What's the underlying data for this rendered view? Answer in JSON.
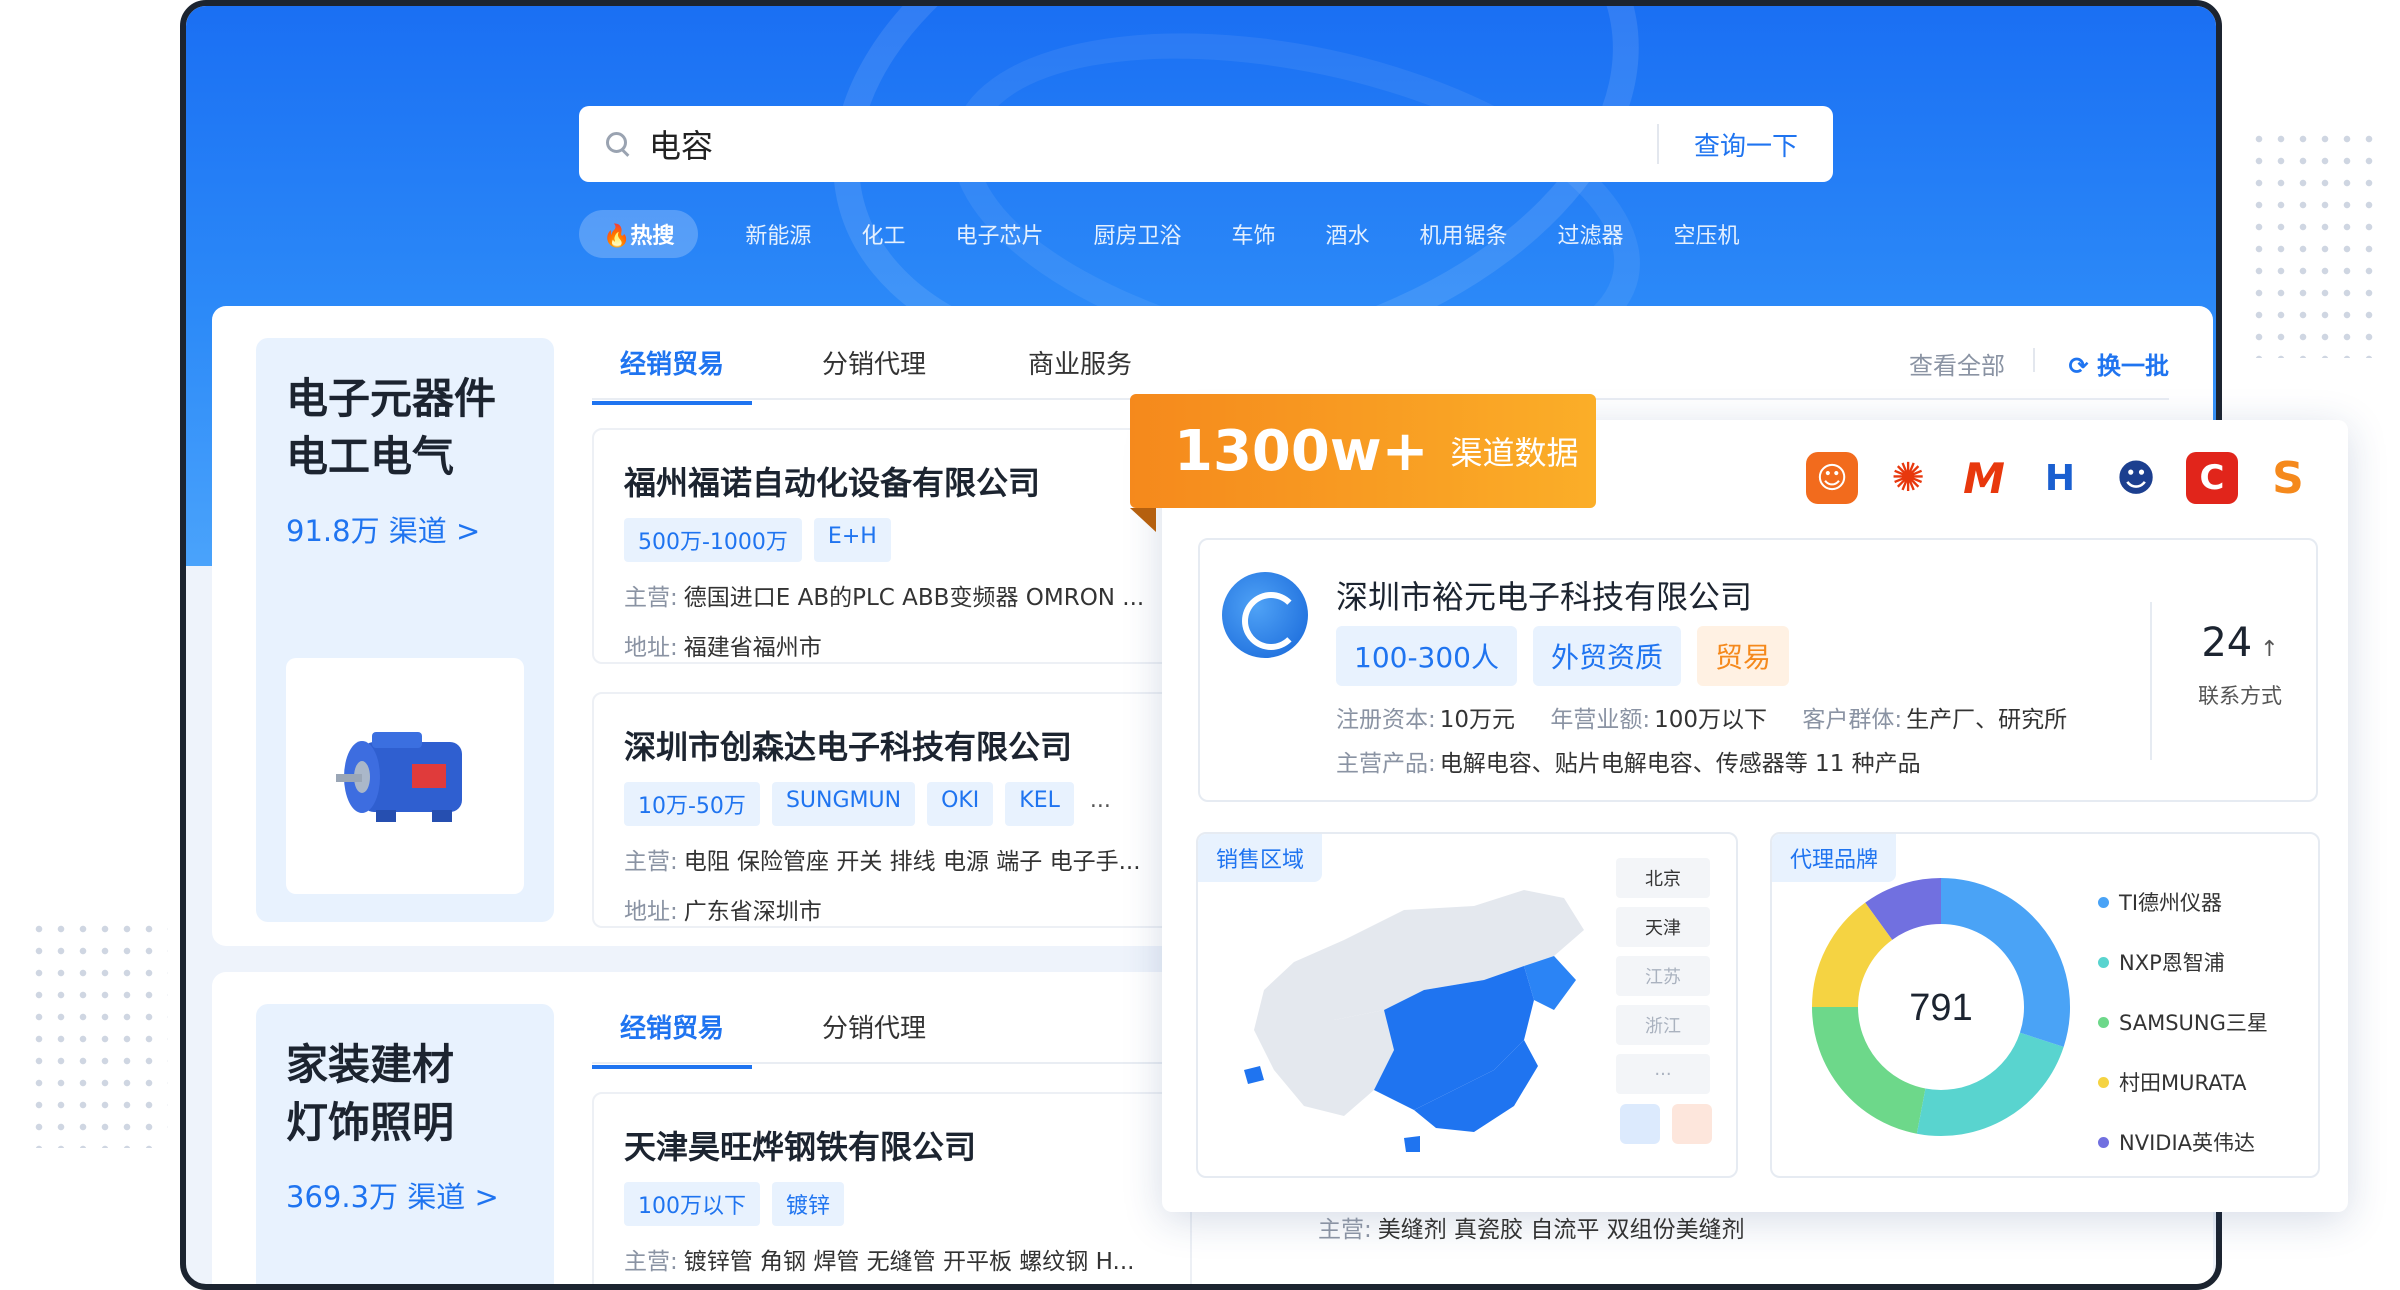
{
  "search": {
    "query": "电容",
    "button_label": "查询一下"
  },
  "hot": {
    "tag": "热搜",
    "items": [
      "新能源",
      "化工",
      "电子芯片",
      "厨房卫浴",
      "车饰",
      "酒水",
      "机用锯条",
      "过滤器",
      "空压机"
    ]
  },
  "section1": {
    "category": {
      "line1": "电子元器件",
      "line2": "电工电气",
      "count": "91.8万 渠道 >"
    },
    "tabs": [
      "经销贸易",
      "分销代理",
      "商业服务"
    ],
    "view_all": "查看全部",
    "refresh": "换一批",
    "companies": [
      {
        "name": "福州福诺自动化设备有限公司",
        "tags": [
          "500万-1000万",
          "E+H"
        ],
        "main_label": "主营:",
        "main": "德国进口E AB的PLC ABB变频器 OMRON ...",
        "addr_label": "地址:",
        "addr": "福建省福州市"
      },
      {
        "name": "深圳市创森达电子科技有限公司",
        "tags": [
          "10万-50万",
          "SUNGMUN",
          "OKI",
          "KEL"
        ],
        "more": "...",
        "main_label": "主营:",
        "main": "电阻 保险管座 开关 排线 电源 端子 电子手...",
        "addr_label": "地址:",
        "addr": "广东省深圳市"
      }
    ]
  },
  "section2": {
    "category": {
      "line1": "家装建材",
      "line2": "灯饰照明",
      "count": "369.3万 渠道 >"
    },
    "tabs": [
      "经销贸易",
      "分销代理"
    ],
    "companies": [
      {
        "name": "天津昊旺烨钢铁有限公司",
        "tags": [
          "100万以下",
          "镀锌"
        ],
        "main_label": "主营:",
        "main": "镀锌管 角钢 焊管 无缝管 开平板 螺纹钢 H..."
      }
    ],
    "second_main_label": "主营:",
    "second_main": "美缝剂 真瓷胶 自流平 双组份美缝剂"
  },
  "overlay": {
    "badge_big": "1300w+",
    "badge_small": "渠道数据",
    "brand_colors": [
      "#f26b1d",
      "#e8380d",
      "#e8380d",
      "#1a5fd0",
      "#1c3f8f",
      "#e1251b",
      "#f5891c"
    ],
    "company": {
      "name": "深圳市裕元电子科技有限公司",
      "tags": [
        "100-300人",
        "外贸资质",
        "贸易"
      ],
      "capital_label": "注册资本:",
      "capital": "10万元",
      "revenue_label": "年营业额:",
      "revenue": "100万以下",
      "customer_label": "客户群体:",
      "customer": "生产厂、研究所",
      "products_label": "主营产品:",
      "products": "电解电容、贴片电解电容、传感器等 11 种产品",
      "contact_count": "24",
      "contact_arrow": "↑",
      "contact_label": "联系方式"
    },
    "sales": {
      "title": "销售区域",
      "regions": [
        "北京",
        "天津",
        "江苏",
        "浙江",
        "···"
      ]
    },
    "brands": {
      "title": "代理品牌",
      "total": "791",
      "items": [
        {
          "name": "TI德州仪器",
          "color": "#4aa3f6",
          "share": 0.3
        },
        {
          "name": "NXP恩智浦",
          "color": "#59d4cf",
          "share": 0.23
        },
        {
          "name": "SAMSUNG三星",
          "color": "#6dd88a",
          "share": 0.22
        },
        {
          "name": "村田MURATA",
          "color": "#f5d342",
          "share": 0.15
        },
        {
          "name": "NVIDIA英伟达",
          "color": "#7170e0",
          "share": 0.1
        }
      ]
    }
  }
}
